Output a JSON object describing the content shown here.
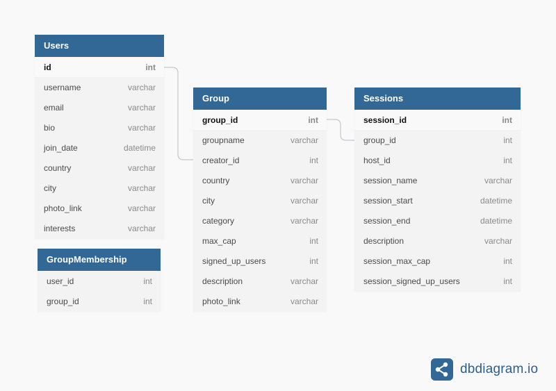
{
  "brand": {
    "name": "dbdiagram.io",
    "color": "#316896"
  },
  "tables": {
    "users": {
      "title": "Users",
      "rows": [
        {
          "name": "id",
          "type": "int"
        },
        {
          "name": "username",
          "type": "varchar"
        },
        {
          "name": "email",
          "type": "varchar"
        },
        {
          "name": "bio",
          "type": "varchar"
        },
        {
          "name": "join_date",
          "type": "datetime"
        },
        {
          "name": "country",
          "type": "varchar"
        },
        {
          "name": "city",
          "type": "varchar"
        },
        {
          "name": "photo_link",
          "type": "varchar"
        },
        {
          "name": "interests",
          "type": "varchar"
        }
      ]
    },
    "group_membership": {
      "title": "GroupMembership",
      "rows": [
        {
          "name": "user_id",
          "type": "int"
        },
        {
          "name": "group_id",
          "type": "int"
        }
      ]
    },
    "group": {
      "title": "Group",
      "rows": [
        {
          "name": "group_id",
          "type": "int"
        },
        {
          "name": "groupname",
          "type": "varchar"
        },
        {
          "name": "creator_id",
          "type": "int"
        },
        {
          "name": "country",
          "type": "varchar"
        },
        {
          "name": "city",
          "type": "varchar"
        },
        {
          "name": "category",
          "type": "varchar"
        },
        {
          "name": "max_cap",
          "type": "int"
        },
        {
          "name": "signed_up_users",
          "type": "int"
        },
        {
          "name": "description",
          "type": "varchar"
        },
        {
          "name": "photo_link",
          "type": "varchar"
        }
      ]
    },
    "sessions": {
      "title": "Sessions",
      "rows": [
        {
          "name": "session_id",
          "type": "int"
        },
        {
          "name": "group_id",
          "type": "int"
        },
        {
          "name": "host_id",
          "type": "int"
        },
        {
          "name": "session_name",
          "type": "varchar"
        },
        {
          "name": "session_start",
          "type": "datetime"
        },
        {
          "name": "session_end",
          "type": "datetime"
        },
        {
          "name": "description",
          "type": "varchar"
        },
        {
          "name": "session_max_cap",
          "type": "int"
        },
        {
          "name": "session_signed_up_users",
          "type": "int"
        }
      ]
    }
  }
}
